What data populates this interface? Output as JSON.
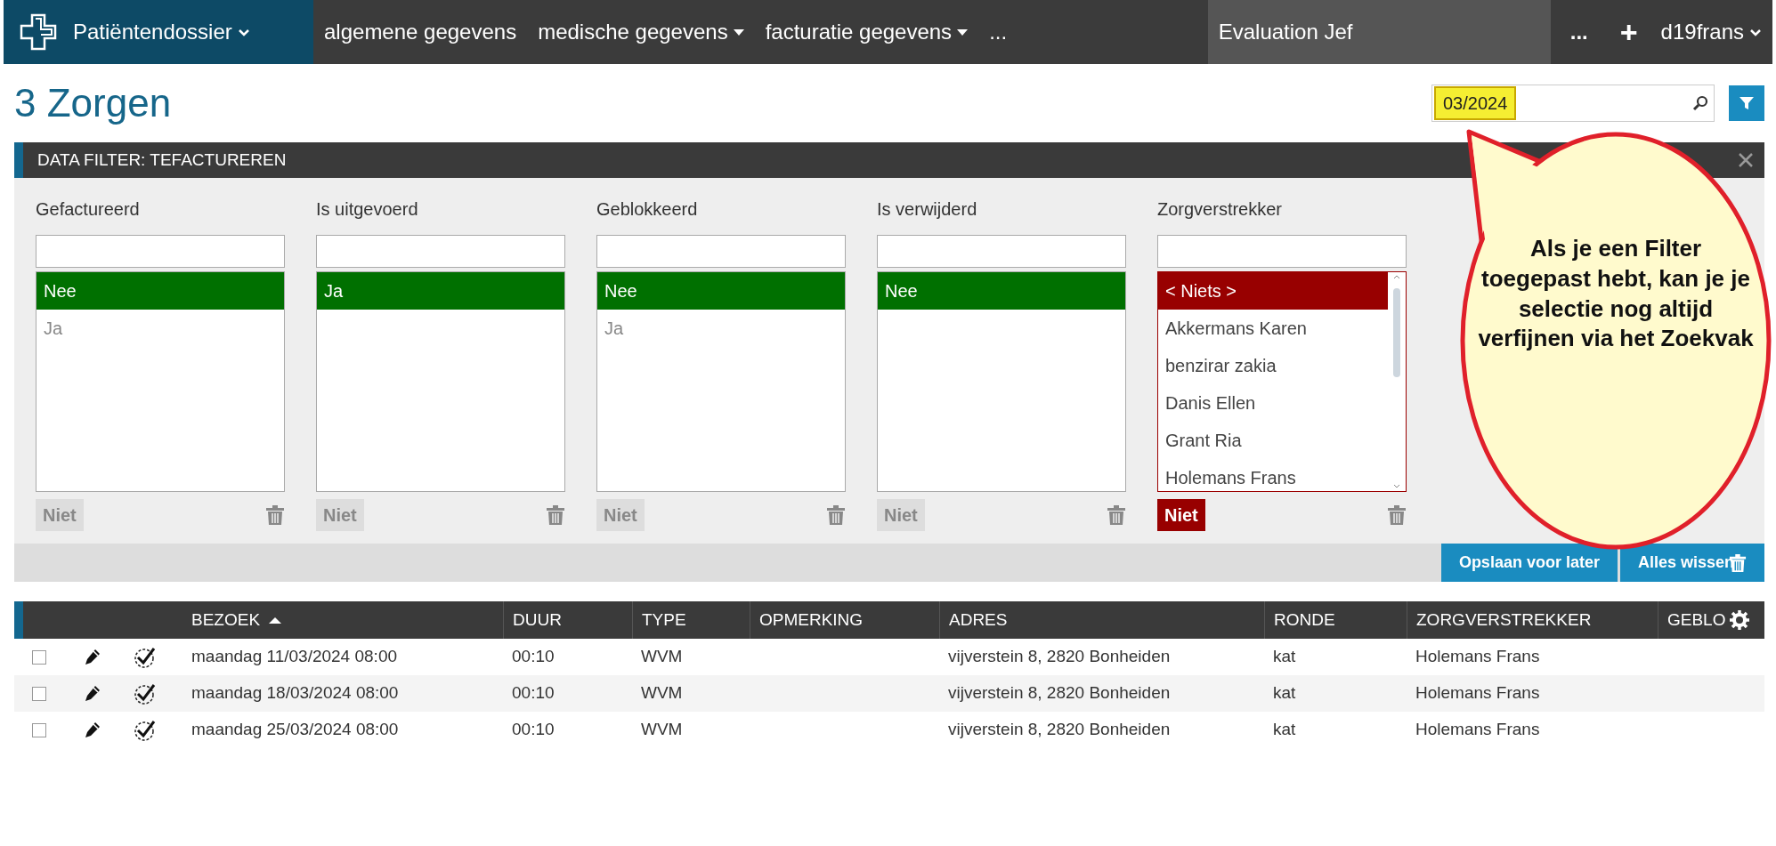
{
  "navbar": {
    "app_menu": "Patiëntendossier",
    "menus": [
      {
        "label": "algemene gegevens",
        "dropdown": false
      },
      {
        "label": "medische gegevens",
        "dropdown": true
      },
      {
        "label": "facturatie gegevens",
        "dropdown": true
      },
      {
        "label": "...",
        "dropdown": false
      }
    ],
    "patient": "Evaluation Jef",
    "more": "...",
    "add": "+",
    "user": "d19frans"
  },
  "page_title": "3 Zorgen",
  "search": {
    "value": "03/2024",
    "highlighted": true
  },
  "filter": {
    "title": "DATA FILTER: TEFACTUREREN",
    "columns": [
      {
        "label": "Gefactureerd",
        "negated": false,
        "scrollable": false,
        "options": [
          {
            "label": "Nee",
            "selected": true
          },
          {
            "label": "Ja",
            "selected": false
          }
        ],
        "niet": "Niet"
      },
      {
        "label": "Is uitgevoerd",
        "negated": false,
        "scrollable": false,
        "options": [
          {
            "label": "Ja",
            "selected": true
          }
        ],
        "niet": "Niet"
      },
      {
        "label": "Geblokkeerd",
        "negated": false,
        "scrollable": false,
        "options": [
          {
            "label": "Nee",
            "selected": true
          },
          {
            "label": "Ja",
            "selected": false
          }
        ],
        "niet": "Niet"
      },
      {
        "label": "Is verwijderd",
        "negated": false,
        "scrollable": false,
        "options": [
          {
            "label": "Nee",
            "selected": true
          }
        ],
        "niet": "Niet"
      },
      {
        "label": "Zorgverstrekker",
        "negated": true,
        "scrollable": true,
        "options": [
          {
            "label": "< Niets >",
            "selected": true
          },
          {
            "label": "Akkermans Karen",
            "selected": false
          },
          {
            "label": "benzirar zakia",
            "selected": false
          },
          {
            "label": "Danis Ellen",
            "selected": false
          },
          {
            "label": "Grant Ria",
            "selected": false
          },
          {
            "label": "Holemans Frans",
            "selected": false
          }
        ],
        "niet": "Niet"
      }
    ],
    "buttons": [
      "Opslaan voor later",
      "Alles wissen"
    ]
  },
  "table": {
    "columns": [
      {
        "label": "BEZOEK",
        "sorted": true
      },
      {
        "label": "DUUR",
        "sorted": false
      },
      {
        "label": "TYPE",
        "sorted": false
      },
      {
        "label": "OPMERKING",
        "sorted": false
      },
      {
        "label": "ADRES",
        "sorted": false
      },
      {
        "label": "RONDE",
        "sorted": false
      },
      {
        "label": "ZORGVERSTREKKER",
        "sorted": false
      },
      {
        "label": "GEBLO",
        "sorted": false
      }
    ],
    "rows": [
      {
        "checked": false,
        "cells": [
          "maandag 11/03/2024 08:00",
          "00:10",
          "WVM",
          "",
          "vijverstein 8, 2820 Bonheiden",
          "kat",
          "Holemans Frans",
          ""
        ]
      },
      {
        "checked": false,
        "cells": [
          "maandag 18/03/2024 08:00",
          "00:10",
          "WVM",
          "",
          "vijverstein 8, 2820 Bonheiden",
          "kat",
          "Holemans Frans",
          ""
        ]
      },
      {
        "checked": false,
        "cells": [
          "maandag 25/03/2024 08:00",
          "00:10",
          "WVM",
          "",
          "vijverstein 8, 2820 Bonheiden",
          "kat",
          "Holemans Frans",
          ""
        ]
      }
    ]
  },
  "callout": "Als je een Filter toegepast hebt, kan je je selectie nog altijd verfijnen via het Zoekvak"
}
